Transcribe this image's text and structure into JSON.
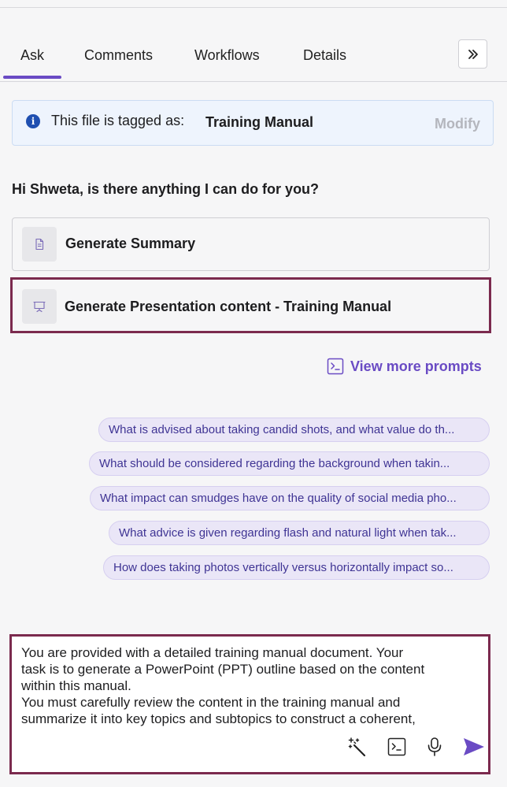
{
  "tabs": [
    {
      "label": "Ask",
      "active": true
    },
    {
      "label": "Comments",
      "active": false
    },
    {
      "label": "Workflows",
      "active": false
    },
    {
      "label": "Details",
      "active": false
    }
  ],
  "expand_icon": "double-chevron-right-icon",
  "tag_banner": {
    "label": "This file is tagged as:",
    "value": "Training Manual",
    "action": "Modify",
    "info_icon": "info-icon",
    "info_glyph": "i"
  },
  "greeting": "Hi Shweta, is there anything I can do for you?",
  "suggestions": [
    {
      "label": "Generate Summary",
      "icon": "document-icon"
    },
    {
      "label": "Generate Presentation content - Training Manual",
      "icon": "presentation-icon"
    }
  ],
  "view_more": {
    "label": "View more prompts",
    "icon": "terminal-icon"
  },
  "prompt_chips": [
    "What is advised about taking candid shots, and what value do th...",
    "What should be considered regarding the background when takin...",
    "What impact can smudges have on the quality of social media pho...",
    "What advice is given regarding flash and natural light when tak...",
    "How does taking photos vertically versus horizontally impact so..."
  ],
  "composer": {
    "text": "You are provided with a detailed training manual document. Your\ntask is to generate a PowerPoint (PPT) outline based on the content\nwithin this manual.\nYou must carefully review the content in the training manual and\nsummarize it into key topics and subtopics to construct a coherent,",
    "icons": [
      "magic-wand-icon",
      "terminal-icon",
      "microphone-icon",
      "send-icon"
    ]
  },
  "colors": {
    "accent": "#6a4bc4",
    "highlight_border": "#7b2a4e",
    "banner_bg": "#eef4fd",
    "chip_bg": "#eae6f7",
    "chip_text": "#3f3494"
  }
}
